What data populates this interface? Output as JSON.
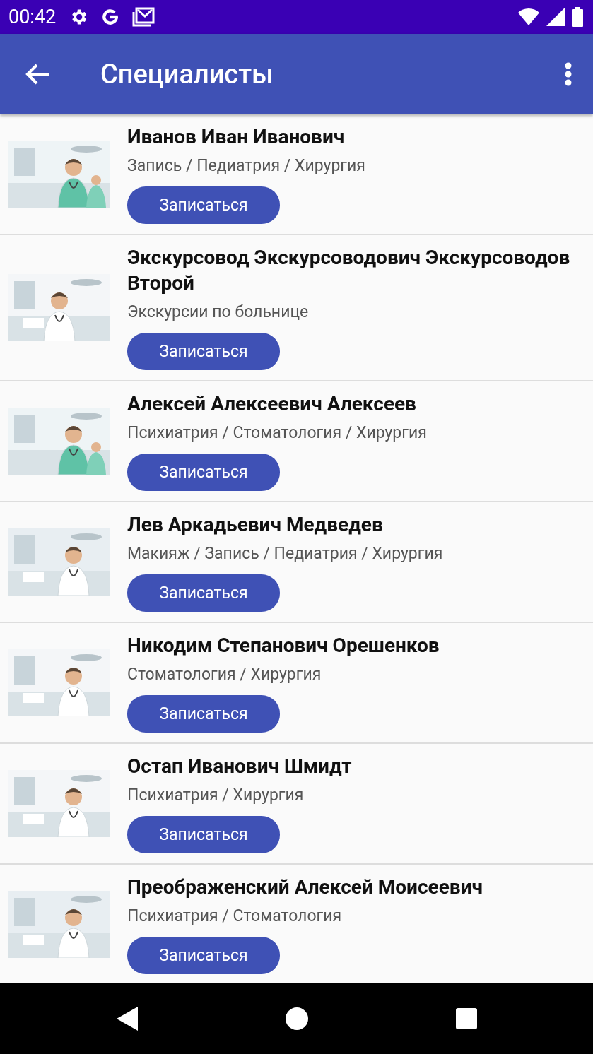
{
  "status_bar": {
    "time": "00:42"
  },
  "app_bar": {
    "title": "Специалисты"
  },
  "specialists": [
    {
      "name": "Иванов Иван Иванович",
      "specialties": "Запись / Педиатрия / Хирургия",
      "button": "Записаться"
    },
    {
      "name": "Экскурсовод Экскурсоводович Экскурсоводов Второй",
      "specialties": "Экскурсии по больнице",
      "button": "Записаться"
    },
    {
      "name": "Алексей Алексеевич Алексеев",
      "specialties": "Психиатрия / Стоматология / Хирургия",
      "button": "Записаться"
    },
    {
      "name": "Лев Аркадьевич Медведев",
      "specialties": "Макияж / Запись / Педиатрия / Хирургия",
      "button": "Записаться"
    },
    {
      "name": "Никодим Степанович Орешенков",
      "specialties": "Стоматология / Хирургия",
      "button": "Записаться"
    },
    {
      "name": "Остап Иванович Шмидт",
      "specialties": "Психиатрия / Хирургия",
      "button": "Записаться"
    },
    {
      "name": "Преображенский Алексей Моисеевич",
      "specialties": "Психиатрия / Стоматология",
      "button": "Записаться"
    }
  ]
}
